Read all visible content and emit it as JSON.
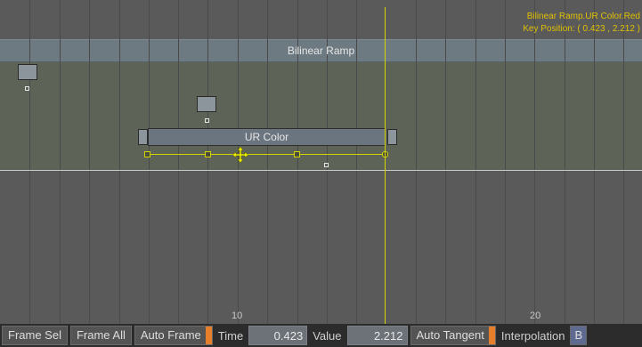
{
  "timeline": {
    "track_label": "Bilinear Ramp",
    "bar_label": "UR Color",
    "info_line1": "Bilinear Ramp.UR Color.Red",
    "info_line2": "Key Position: ( 0.423 , 2.212 )",
    "frame_labels": [
      "10",
      "20"
    ]
  },
  "toolbar": {
    "frame_sel": "Frame Sel",
    "frame_all": "Frame All",
    "auto_frame": "Auto Frame",
    "time_label": "Time",
    "time_value": "0.423",
    "value_label": "Value",
    "value_value": "2.212",
    "auto_tangent": "Auto Tangent",
    "interpolation_label": "Interpolation",
    "interpolation_button": "B"
  },
  "colors": {
    "accent_orange": "#e77f2a",
    "cursor_yellow": "#d4d400"
  }
}
